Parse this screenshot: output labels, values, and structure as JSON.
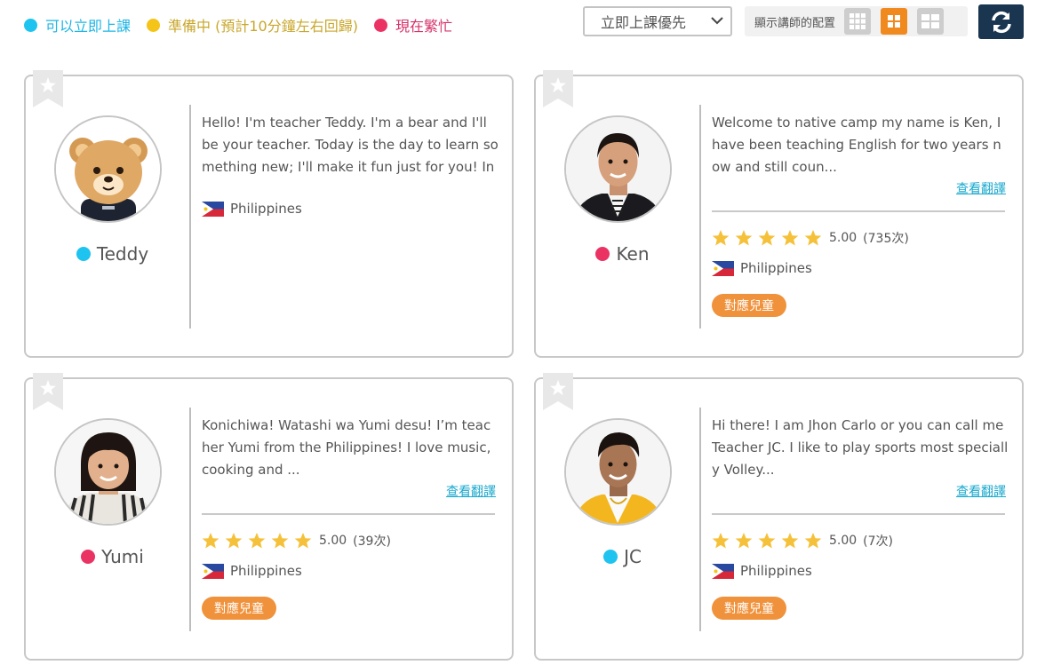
{
  "legend": [
    {
      "label": "可以立即上課",
      "color": "#1ec3f0",
      "text_color": "#1eb6e6"
    },
    {
      "label": "準備中 (預計10分鐘左右回歸)",
      "color": "#f4c418",
      "text_color": "#c9a72b"
    },
    {
      "label": "現在繁忙",
      "color": "#ea3362",
      "text_color": "#d6336a"
    }
  ],
  "sort": {
    "selected": "立即上課優先"
  },
  "layout": {
    "label": "顯示講師的配置",
    "options": [
      "grid-3x3-icon",
      "grid-2x2-icon",
      "grid-2x2-large-icon"
    ],
    "active_index": 1
  },
  "refresh": {
    "icon": "refresh-icon"
  },
  "teachers": [
    {
      "name": "Teddy",
      "status": "available",
      "intro": "Hello! I'm teacher Teddy. I'm a bear and I'll be your teacher. Today is the day to learn something new; I'll make it fun just for you! In my class",
      "country": "Philippines",
      "has_rating": false
    },
    {
      "name": "Ken",
      "status": "busy",
      "intro": "Welcome to native camp my name is Ken, I have been teaching English for two years now and still coun...",
      "translate_label": "查看翻譯",
      "rating": 5.0,
      "rating_text": "5.00",
      "count_text": "(735次)",
      "country": "Philippines",
      "badge": "對應兒童",
      "has_rating": true
    },
    {
      "name": "Yumi",
      "status": "busy",
      "intro": "Konichiwa! Watashi wa Yumi desu! I’m teacher Yumi from the Philippines! I love music, cooking and ...",
      "translate_label": "查看翻譯",
      "rating": 5.0,
      "rating_text": "5.00",
      "count_text": "(39次)",
      "country": "Philippines",
      "badge": "對應兒童",
      "has_rating": true
    },
    {
      "name": "JC",
      "status": "available",
      "intro": "Hi there! I am Jhon Carlo or you can call me Teacher JC. I like to play sports most specially Volley...",
      "translate_label": "查看翻譯",
      "rating": 5.0,
      "rating_text": "5.00",
      "count_text": "(7次)",
      "country": "Philippines",
      "badge": "對應兒童",
      "has_rating": true
    }
  ],
  "colors": {
    "available": "#1ec3f0",
    "busy": "#ea3362",
    "star": "#f6c13a",
    "badge": "#f0923c",
    "link": "#1aa9cf"
  }
}
